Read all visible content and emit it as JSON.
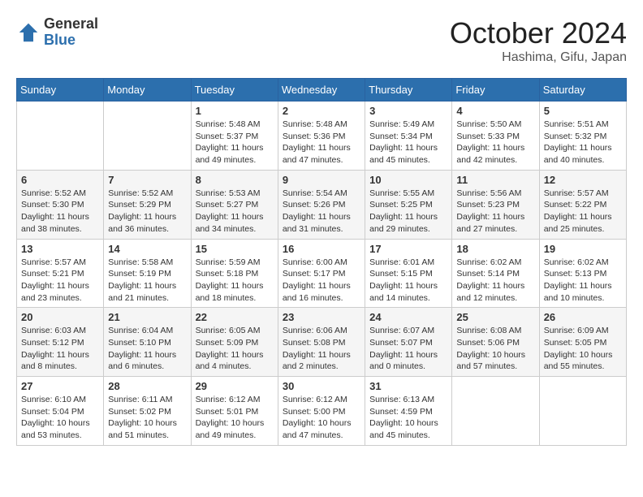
{
  "header": {
    "logo_general": "General",
    "logo_blue": "Blue",
    "month_title": "October 2024",
    "location": "Hashima, Gifu, Japan"
  },
  "days_of_week": [
    "Sunday",
    "Monday",
    "Tuesday",
    "Wednesday",
    "Thursday",
    "Friday",
    "Saturday"
  ],
  "weeks": [
    [
      {
        "day": "",
        "sunrise": "",
        "sunset": "",
        "daylight": ""
      },
      {
        "day": "",
        "sunrise": "",
        "sunset": "",
        "daylight": ""
      },
      {
        "day": "1",
        "sunrise": "Sunrise: 5:48 AM",
        "sunset": "Sunset: 5:37 PM",
        "daylight": "Daylight: 11 hours and 49 minutes."
      },
      {
        "day": "2",
        "sunrise": "Sunrise: 5:48 AM",
        "sunset": "Sunset: 5:36 PM",
        "daylight": "Daylight: 11 hours and 47 minutes."
      },
      {
        "day": "3",
        "sunrise": "Sunrise: 5:49 AM",
        "sunset": "Sunset: 5:34 PM",
        "daylight": "Daylight: 11 hours and 45 minutes."
      },
      {
        "day": "4",
        "sunrise": "Sunrise: 5:50 AM",
        "sunset": "Sunset: 5:33 PM",
        "daylight": "Daylight: 11 hours and 42 minutes."
      },
      {
        "day": "5",
        "sunrise": "Sunrise: 5:51 AM",
        "sunset": "Sunset: 5:32 PM",
        "daylight": "Daylight: 11 hours and 40 minutes."
      }
    ],
    [
      {
        "day": "6",
        "sunrise": "Sunrise: 5:52 AM",
        "sunset": "Sunset: 5:30 PM",
        "daylight": "Daylight: 11 hours and 38 minutes."
      },
      {
        "day": "7",
        "sunrise": "Sunrise: 5:52 AM",
        "sunset": "Sunset: 5:29 PM",
        "daylight": "Daylight: 11 hours and 36 minutes."
      },
      {
        "day": "8",
        "sunrise": "Sunrise: 5:53 AM",
        "sunset": "Sunset: 5:27 PM",
        "daylight": "Daylight: 11 hours and 34 minutes."
      },
      {
        "day": "9",
        "sunrise": "Sunrise: 5:54 AM",
        "sunset": "Sunset: 5:26 PM",
        "daylight": "Daylight: 11 hours and 31 minutes."
      },
      {
        "day": "10",
        "sunrise": "Sunrise: 5:55 AM",
        "sunset": "Sunset: 5:25 PM",
        "daylight": "Daylight: 11 hours and 29 minutes."
      },
      {
        "day": "11",
        "sunrise": "Sunrise: 5:56 AM",
        "sunset": "Sunset: 5:23 PM",
        "daylight": "Daylight: 11 hours and 27 minutes."
      },
      {
        "day": "12",
        "sunrise": "Sunrise: 5:57 AM",
        "sunset": "Sunset: 5:22 PM",
        "daylight": "Daylight: 11 hours and 25 minutes."
      }
    ],
    [
      {
        "day": "13",
        "sunrise": "Sunrise: 5:57 AM",
        "sunset": "Sunset: 5:21 PM",
        "daylight": "Daylight: 11 hours and 23 minutes."
      },
      {
        "day": "14",
        "sunrise": "Sunrise: 5:58 AM",
        "sunset": "Sunset: 5:19 PM",
        "daylight": "Daylight: 11 hours and 21 minutes."
      },
      {
        "day": "15",
        "sunrise": "Sunrise: 5:59 AM",
        "sunset": "Sunset: 5:18 PM",
        "daylight": "Daylight: 11 hours and 18 minutes."
      },
      {
        "day": "16",
        "sunrise": "Sunrise: 6:00 AM",
        "sunset": "Sunset: 5:17 PM",
        "daylight": "Daylight: 11 hours and 16 minutes."
      },
      {
        "day": "17",
        "sunrise": "Sunrise: 6:01 AM",
        "sunset": "Sunset: 5:15 PM",
        "daylight": "Daylight: 11 hours and 14 minutes."
      },
      {
        "day": "18",
        "sunrise": "Sunrise: 6:02 AM",
        "sunset": "Sunset: 5:14 PM",
        "daylight": "Daylight: 11 hours and 12 minutes."
      },
      {
        "day": "19",
        "sunrise": "Sunrise: 6:02 AM",
        "sunset": "Sunset: 5:13 PM",
        "daylight": "Daylight: 11 hours and 10 minutes."
      }
    ],
    [
      {
        "day": "20",
        "sunrise": "Sunrise: 6:03 AM",
        "sunset": "Sunset: 5:12 PM",
        "daylight": "Daylight: 11 hours and 8 minutes."
      },
      {
        "day": "21",
        "sunrise": "Sunrise: 6:04 AM",
        "sunset": "Sunset: 5:10 PM",
        "daylight": "Daylight: 11 hours and 6 minutes."
      },
      {
        "day": "22",
        "sunrise": "Sunrise: 6:05 AM",
        "sunset": "Sunset: 5:09 PM",
        "daylight": "Daylight: 11 hours and 4 minutes."
      },
      {
        "day": "23",
        "sunrise": "Sunrise: 6:06 AM",
        "sunset": "Sunset: 5:08 PM",
        "daylight": "Daylight: 11 hours and 2 minutes."
      },
      {
        "day": "24",
        "sunrise": "Sunrise: 6:07 AM",
        "sunset": "Sunset: 5:07 PM",
        "daylight": "Daylight: 11 hours and 0 minutes."
      },
      {
        "day": "25",
        "sunrise": "Sunrise: 6:08 AM",
        "sunset": "Sunset: 5:06 PM",
        "daylight": "Daylight: 10 hours and 57 minutes."
      },
      {
        "day": "26",
        "sunrise": "Sunrise: 6:09 AM",
        "sunset": "Sunset: 5:05 PM",
        "daylight": "Daylight: 10 hours and 55 minutes."
      }
    ],
    [
      {
        "day": "27",
        "sunrise": "Sunrise: 6:10 AM",
        "sunset": "Sunset: 5:04 PM",
        "daylight": "Daylight: 10 hours and 53 minutes."
      },
      {
        "day": "28",
        "sunrise": "Sunrise: 6:11 AM",
        "sunset": "Sunset: 5:02 PM",
        "daylight": "Daylight: 10 hours and 51 minutes."
      },
      {
        "day": "29",
        "sunrise": "Sunrise: 6:12 AM",
        "sunset": "Sunset: 5:01 PM",
        "daylight": "Daylight: 10 hours and 49 minutes."
      },
      {
        "day": "30",
        "sunrise": "Sunrise: 6:12 AM",
        "sunset": "Sunset: 5:00 PM",
        "daylight": "Daylight: 10 hours and 47 minutes."
      },
      {
        "day": "31",
        "sunrise": "Sunrise: 6:13 AM",
        "sunset": "Sunset: 4:59 PM",
        "daylight": "Daylight: 10 hours and 45 minutes."
      },
      {
        "day": "",
        "sunrise": "",
        "sunset": "",
        "daylight": ""
      },
      {
        "day": "",
        "sunrise": "",
        "sunset": "",
        "daylight": ""
      }
    ]
  ]
}
